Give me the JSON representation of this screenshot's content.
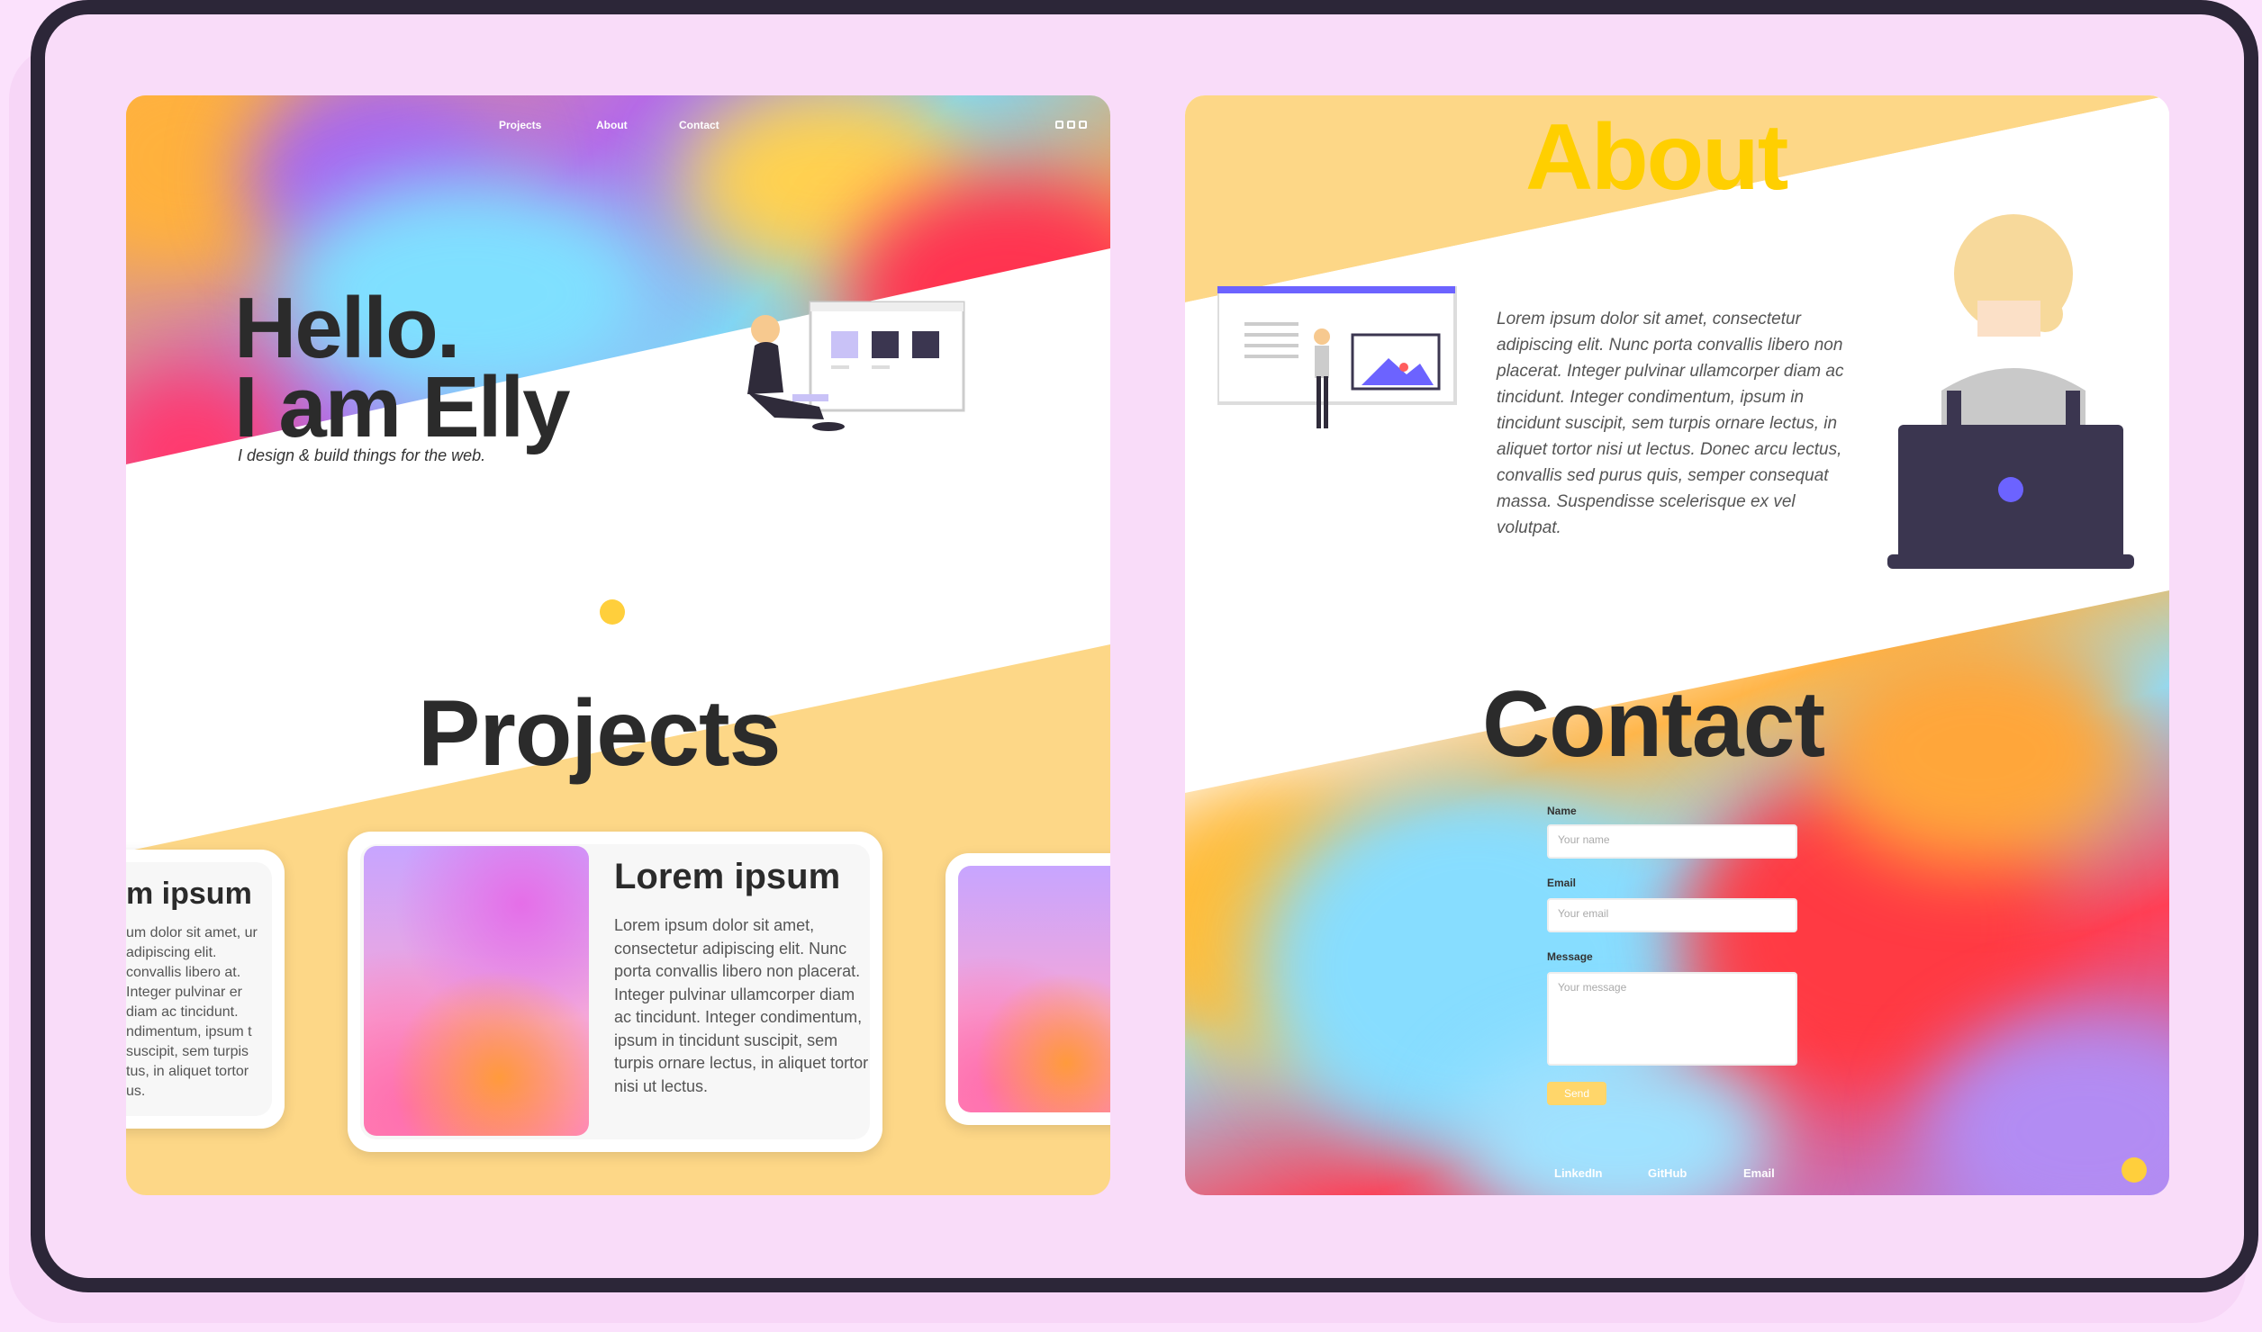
{
  "colors": {
    "frame_border": "#2c2638",
    "background": "#fbe1fc",
    "accent_yellow": "#ffcf3c",
    "about_yellow": "#ffcf00",
    "text_dark": "#2b2b2b"
  },
  "left_page": {
    "nav": {
      "links": [
        "Projects",
        "About",
        "Contact"
      ],
      "icons": [
        "instagram-icon",
        "linkedin-icon",
        "github-icon"
      ]
    },
    "hero": {
      "line1": "Hello.",
      "line2": "I am Elly",
      "tagline": "I design & build things for the web."
    },
    "projects": {
      "title": "Projects",
      "cards": [
        {
          "title": "m ipsum",
          "text": "um dolor sit amet, ur adipiscing elit. convallis libero at. Integer pulvinar er diam ac tincidunt. ndimentum, ipsum t suscipit, sem turpis tus, in aliquet tortor us."
        },
        {
          "title": "Lorem ipsum",
          "text": "Lorem ipsum dolor sit amet, consectetur adipiscing elit. Nunc porta convallis libero non placerat. Integer pulvinar ullamcorper diam ac tincidunt. Integer condimentum, ipsum in tincidunt suscipit, sem turpis ornare lectus, in aliquet tortor nisi ut lectus."
        }
      ]
    }
  },
  "right_page": {
    "about": {
      "title": "About",
      "text": "Lorem ipsum dolor sit amet, consectetur adipiscing elit. Nunc porta convallis libero non placerat. Integer pulvinar ullamcorper diam ac tincidunt. Integer condimentum, ipsum in tincidunt suscipit, sem turpis ornare lectus, in aliquet tortor nisi ut lectus. Donec arcu lectus, convallis sed purus quis, semper consequat massa. Suspendisse scelerisque ex vel volutpat."
    },
    "contact": {
      "title": "Contact",
      "name_label": "Name",
      "name_placeholder": "Your name",
      "email_label": "Email",
      "email_placeholder": "Your email",
      "message_label": "Message",
      "message_placeholder": "Your message",
      "send_label": "Send"
    },
    "footer": {
      "links": [
        "LinkedIn",
        "GitHub",
        "Email"
      ]
    }
  }
}
